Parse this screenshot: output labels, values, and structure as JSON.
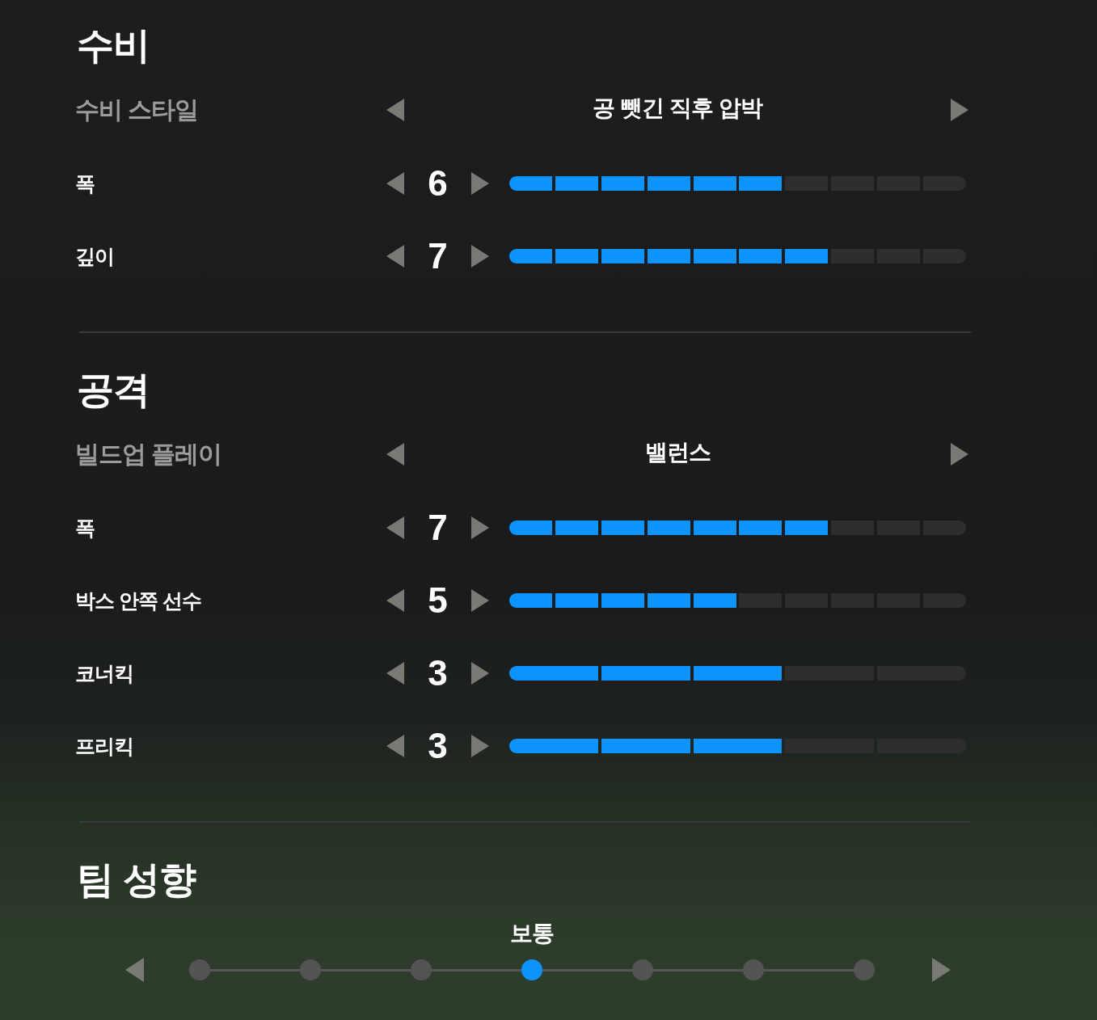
{
  "sections": [
    {
      "title": "수비",
      "style": {
        "label": "수비 스타일",
        "value": "공 뺏긴 직후 압박"
      },
      "rows": [
        {
          "label": "폭",
          "value": "6",
          "level": 0.6,
          "kind": "decile"
        },
        {
          "label": "깊이",
          "value": "7",
          "level": 0.7,
          "kind": "decile"
        }
      ]
    },
    {
      "title": "공격",
      "style": {
        "label": "빌드업 플레이",
        "value": "밸런스"
      },
      "rows": [
        {
          "label": "폭",
          "value": "7",
          "level": 0.7,
          "kind": "decile"
        },
        {
          "label": "박스 안쪽 선수",
          "value": "5",
          "level": 0.5,
          "kind": "decile"
        },
        {
          "label": "코너킥",
          "value": "3",
          "level": 0.6,
          "kind": "quintile"
        },
        {
          "label": "프리킥",
          "value": "3",
          "level": 0.6,
          "kind": "quintile"
        }
      ]
    }
  ],
  "team_tendency": {
    "title": "팀 성향",
    "label": "보통",
    "steps": [
      {
        "selected": false
      },
      {
        "selected": false
      },
      {
        "selected": false
      },
      {
        "selected": true
      },
      {
        "selected": false
      },
      {
        "selected": false
      },
      {
        "selected": false
      }
    ]
  }
}
